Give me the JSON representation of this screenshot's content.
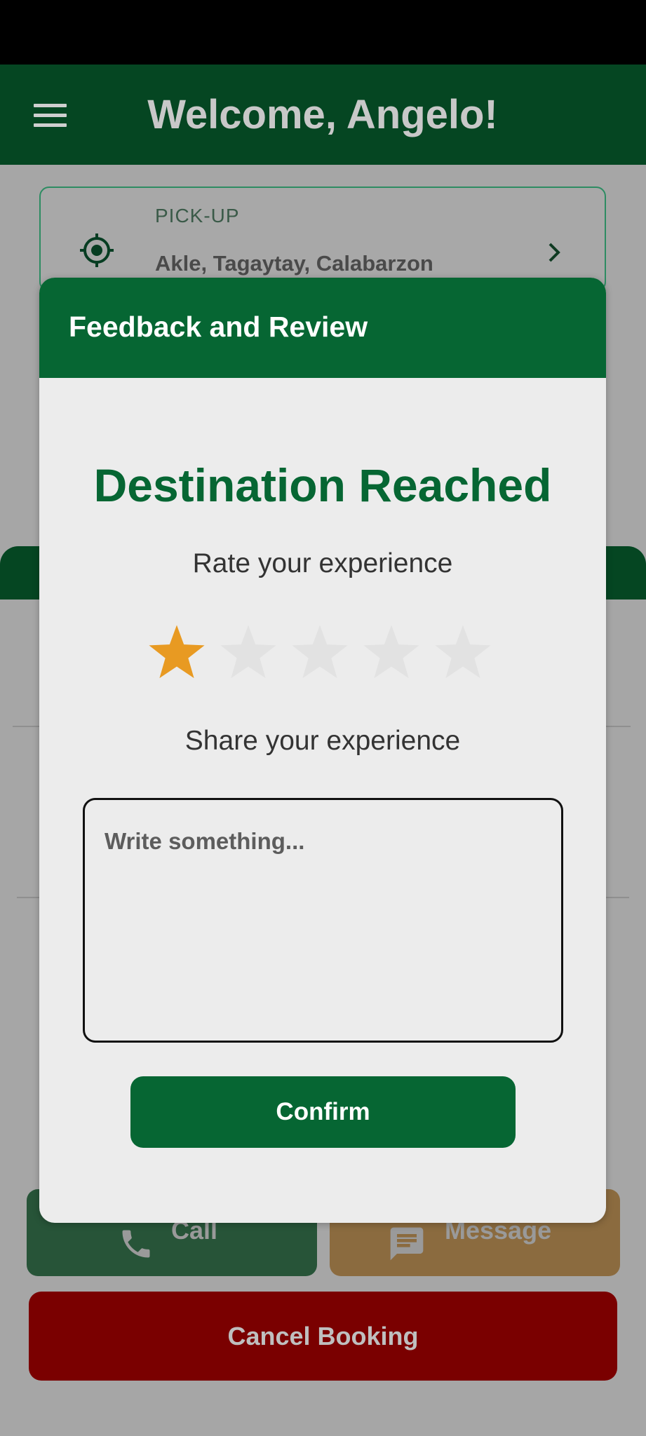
{
  "header": {
    "title": "Welcome, Angelo!",
    "menu_icon": "hamburger-menu-icon"
  },
  "pickup": {
    "label": "PICK-UP",
    "address": "Akle, Tagaytay, Calabarzon",
    "icon": "location-target-icon"
  },
  "dialog": {
    "title": "Feedback and Review",
    "heading": "Destination Reached",
    "rate_label": "Rate your experience",
    "rating": {
      "value": 1,
      "max": 5
    },
    "share_label": "Share your experience",
    "input": {
      "placeholder": "Write something...",
      "value": ""
    },
    "confirm_label": "Confirm"
  },
  "actions": {
    "call_label": "Call",
    "message_label": "Message",
    "cancel_label": "Cancel Booking"
  },
  "colors": {
    "brand_green": "#066633",
    "dark_green": "#054622",
    "star_filled": "#e89a22",
    "star_empty": "#e2e2e2",
    "cancel_red": "#7a0000"
  }
}
